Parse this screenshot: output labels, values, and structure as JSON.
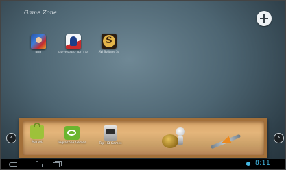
{
  "folder": {
    "title": "Game Zone"
  },
  "actions": {
    "add_icon": "plus-icon"
  },
  "apps": [
    {
      "label": "BMX",
      "icon": "bmx-game-icon"
    },
    {
      "label": "Backbreaker THD Lite",
      "icon": "backbreaker-icon"
    },
    {
      "label": "AW Solitaire 3d",
      "icon": "solitaire-icon"
    }
  ],
  "tray": {
    "items": [
      {
        "label": "Market",
        "icon": "market-bag-icon"
      },
      {
        "label": "TegraZone Games",
        "icon": "tegrazone-icon"
      },
      {
        "label": "Top HD Games",
        "icon": "top-hd-games-icon"
      }
    ],
    "decorations": [
      "golden-egg-icon",
      "robot-figure-icon",
      "spaceship-icon"
    ]
  },
  "navigation": {
    "left_arrow": "‹",
    "right_arrow": "›"
  },
  "system_bar": {
    "time": "8:11",
    "accent": "#44b8e3"
  }
}
